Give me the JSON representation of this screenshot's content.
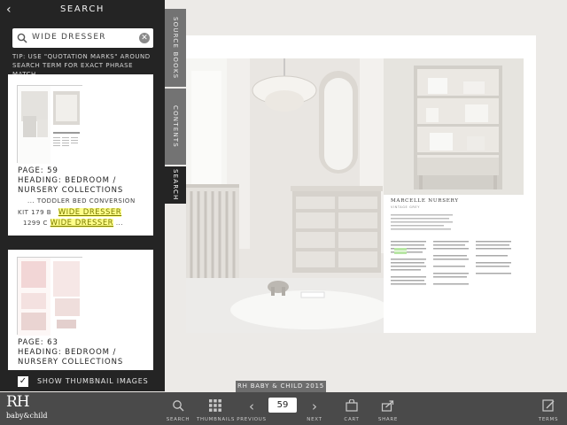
{
  "panel": {
    "title": "SEARCH",
    "search_value": "WIDE DRESSER",
    "tip": "TIP: USE \"QUOTATION MARKS\" AROUND SEARCH TERM FOR EXACT PHRASE MATCH",
    "results": [
      {
        "page": "PAGE: 59",
        "heading": "HEADING: BEDROOM / NURSERY COLLECTIONS",
        "snippet1": "... TODDLER BED CONVERSION",
        "snippet2_prefix": "KIT 179 B",
        "snippet2_hl": "WIDE DRESSER",
        "snippet3_prefix": "1299 C",
        "snippet3_hl": "WIDE DRESSER",
        "snippet3_suffix": "..."
      },
      {
        "page": "PAGE: 63",
        "heading": "HEADING: BEDROOM / NURSERY COLLECTIONS"
      }
    ],
    "show_thumbnails_label": "SHOW THUMBNAIL IMAGES",
    "show_thumbnails_checked": true
  },
  "side_tabs": [
    "SOURCE BOOKS",
    "CONTENTS",
    "SEARCH"
  ],
  "page": {
    "right_title": "MARCELLE NURSERY",
    "right_subtitle": "VINTAGE GREY"
  },
  "chapter_label": "RH BABY & CHILD 2015",
  "toolbar": {
    "brand": "RH",
    "brand_sub": "baby&child",
    "search": "SEARCH",
    "thumbnails": "THUMBNAILS",
    "previous": "PREVIOUS",
    "page_number": "59",
    "next": "NEXT",
    "cart": "CART",
    "share": "SHARE",
    "terms": "TERMS"
  },
  "colors": {
    "panel_bg": "#242424",
    "toolbar_bg": "#4a4a4a",
    "highlight": "#ffff8a"
  }
}
